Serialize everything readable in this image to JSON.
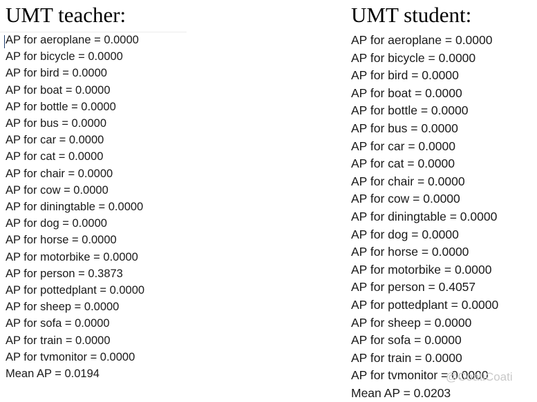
{
  "background_color": "#ffffff",
  "text_color": "#1a1a1a",
  "caret": {
    "name": "text-cursor",
    "color": "#1b3a6b"
  },
  "watermark": {
    "text": "@CoatiCoati",
    "color": "#c9c9c9"
  },
  "panels": [
    {
      "id": "teacher",
      "heading": "UMT teacher:",
      "lines": [
        "AP for aeroplane = 0.0000",
        "AP for bicycle = 0.0000",
        "AP for bird = 0.0000",
        "AP for boat = 0.0000",
        "AP for bottle = 0.0000",
        "AP for bus = 0.0000",
        "AP for car = 0.0000",
        "AP for cat = 0.0000",
        "AP for chair = 0.0000",
        "AP for cow = 0.0000",
        "AP for diningtable = 0.0000",
        "AP for dog = 0.0000",
        "AP for horse = 0.0000",
        "AP for motorbike = 0.0000",
        "AP for person = 0.3873",
        "AP for pottedplant = 0.0000",
        "AP for sheep = 0.0000",
        "AP for sofa = 0.0000",
        "AP for train = 0.0000",
        "AP for tvmonitor = 0.0000",
        "Mean AP = 0.0194"
      ],
      "metrics": {
        "aeroplane": "0.0000",
        "bicycle": "0.0000",
        "bird": "0.0000",
        "boat": "0.0000",
        "bottle": "0.0000",
        "bus": "0.0000",
        "car": "0.0000",
        "cat": "0.0000",
        "chair": "0.0000",
        "cow": "0.0000",
        "diningtable": "0.0000",
        "dog": "0.0000",
        "horse": "0.0000",
        "motorbike": "0.0000",
        "person": "0.3873",
        "pottedplant": "0.0000",
        "sheep": "0.0000",
        "sofa": "0.0000",
        "train": "0.0000",
        "tvmonitor": "0.0000",
        "mean_ap": "0.0194"
      }
    },
    {
      "id": "student",
      "heading": "UMT student:",
      "lines": [
        "AP for aeroplane = 0.0000",
        "AP for bicycle = 0.0000",
        "AP for bird = 0.0000",
        "AP for boat = 0.0000",
        "AP for bottle = 0.0000",
        "AP for bus = 0.0000",
        "AP for car = 0.0000",
        "AP for cat = 0.0000",
        "AP for chair = 0.0000",
        "AP for cow = 0.0000",
        "AP for diningtable = 0.0000",
        "AP for dog = 0.0000",
        "AP for horse = 0.0000",
        "AP for motorbike = 0.0000",
        "AP for person = 0.4057",
        "AP for pottedplant = 0.0000",
        "AP for sheep = 0.0000",
        "AP for sofa = 0.0000",
        "AP for train = 0.0000",
        "AP for tvmonitor = 0.0000",
        "Mean AP = 0.0203"
      ],
      "metrics": {
        "aeroplane": "0.0000",
        "bicycle": "0.0000",
        "bird": "0.0000",
        "boat": "0.0000",
        "bottle": "0.0000",
        "bus": "0.0000",
        "car": "0.0000",
        "cat": "0.0000",
        "chair": "0.0000",
        "cow": "0.0000",
        "diningtable": "0.0000",
        "dog": "0.0000",
        "horse": "0.0000",
        "motorbike": "0.0000",
        "person": "0.4057",
        "pottedplant": "0.0000",
        "sheep": "0.0000",
        "sofa": "0.0000",
        "train": "0.0000",
        "tvmonitor": "0.0000",
        "mean_ap": "0.0203"
      }
    }
  ]
}
